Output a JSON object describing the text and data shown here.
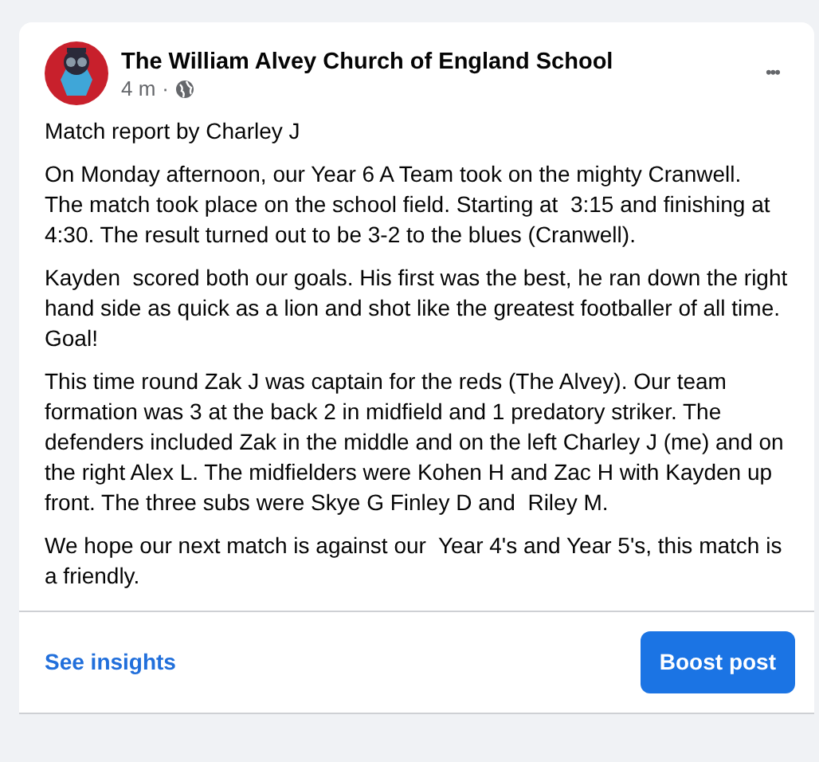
{
  "post": {
    "author": "The William Alvey Church of England School",
    "time": "4 m",
    "separator": "·",
    "menu": "•••",
    "paragraphs": [
      "Match report by Charley J",
      "On Monday afternoon, our Year 6 A Team took on the mighty Cranwell.  The match took place on the school field. Starting at  3:15 and finishing at 4:30. The result turned out to be 3-2 to the blues (Cranwell).",
      "Kayden  scored both our goals. His first was the best, he ran down the right hand side as quick as a lion and shot like the greatest footballer of all time. Goal!",
      "This time round Zak J was captain for the reds (The Alvey). Our team formation was 3 at the back 2 in midfield and 1 predatory striker. The defenders included Zak in the middle and on the left Charley J (me) and on the right Alex L. The midfielders were Kohen H and Zac H with Kayden up front. The three subs were Skye G Finley D and  Riley M.",
      "We hope our next match is against our  Year 4's and Year 5's, this match is a friendly."
    ]
  },
  "footer": {
    "link": "See insights",
    "button": "Boost post"
  }
}
